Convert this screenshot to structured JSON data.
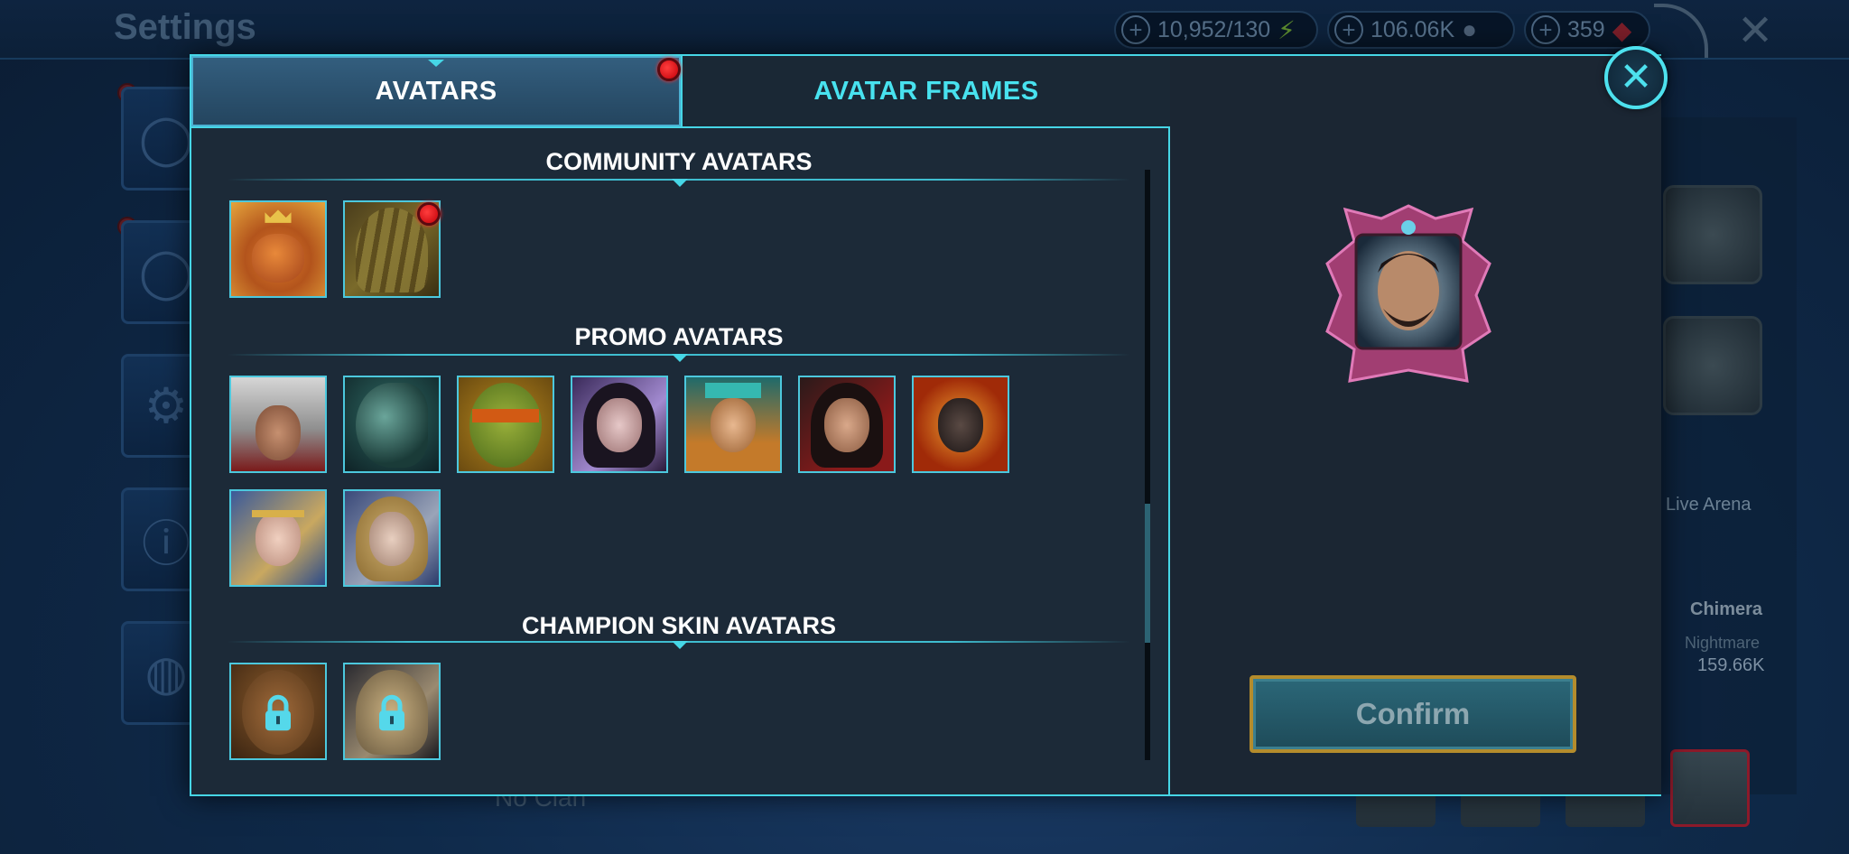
{
  "background": {
    "title": "Settings",
    "resources": [
      {
        "value": "10,952/130",
        "icon": "energy-icon",
        "color": "#7fd13b"
      },
      {
        "value": "106.06K",
        "icon": "silver-coin-icon",
        "color": "#8a9bb0"
      },
      {
        "value": "359",
        "icon": "gem-icon",
        "color": "#d4283a"
      }
    ],
    "right_panel": {
      "live_arena": "Live Arena",
      "boss_name": "Chimera",
      "difficulty": "Nightmare",
      "damage": "159.66K"
    },
    "clan": "No Clan"
  },
  "modal": {
    "tabs": [
      {
        "label": "AVATARS",
        "active": true,
        "notification": true
      },
      {
        "label": "AVATAR FRAMES",
        "active": false,
        "notification": false
      }
    ],
    "sections": [
      {
        "title": "COMMUNITY AVATARS",
        "avatars": [
          "roast-chicken-king",
          "hooded-figure"
        ]
      },
      {
        "title": "PROMO AVATARS",
        "avatars": [
          "assassin-hooded",
          "alien-xenomorph",
          "ninja-turtle",
          "dark-haired-woman",
          "jeweled-warrior",
          "red-hooded-woman",
          "fire-demon",
          "elf-warrior-woman",
          "scarred-blonde-warrior"
        ]
      },
      {
        "title": "CHAMPION SKIN AVATARS",
        "avatars": [
          "monkey-king-locked",
          "blonde-woman-locked"
        ]
      }
    ],
    "confirm_label": "Confirm",
    "close_icon": "close-icon",
    "accent_color": "#46d6e6"
  }
}
